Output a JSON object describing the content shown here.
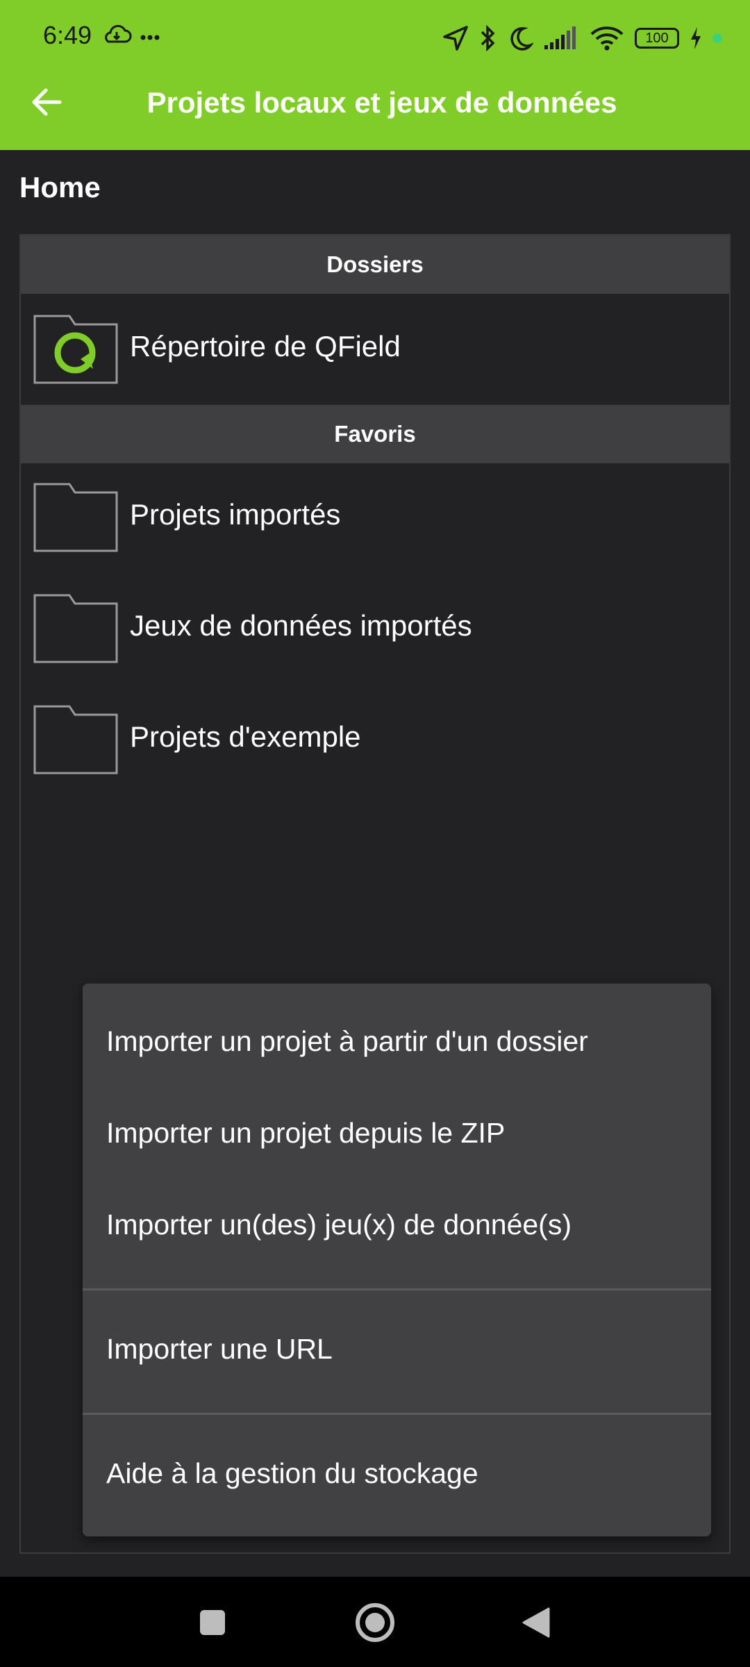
{
  "status_bar": {
    "time": "6:49",
    "battery": "100",
    "icons": [
      "cloud-download-icon",
      "more-dots-icon",
      "location-icon",
      "bluetooth-icon",
      "moon-icon",
      "signal-icon",
      "wifi-icon",
      "battery-icon",
      "charging-icon"
    ]
  },
  "appbar": {
    "title": "Projets locaux et jeux de données",
    "back_icon": "arrow-left-icon"
  },
  "breadcrumb": "Home",
  "sections": {
    "folders_header": "Dossiers",
    "favorites_header": "Favoris"
  },
  "folders": [
    {
      "label": "Répertoire de QField",
      "icon": "qfield-folder-icon"
    }
  ],
  "favorites": [
    {
      "label": "Projets importés",
      "icon": "folder-icon"
    },
    {
      "label": "Jeux de données importés",
      "icon": "folder-icon"
    },
    {
      "label": "Projets d'exemple",
      "icon": "folder-icon"
    }
  ],
  "menu": {
    "items": [
      "Importer un projet à partir d'un dossier",
      "Importer un projet depuis le ZIP",
      "Importer un(des) jeu(x) de donnée(s)",
      "Importer une URL",
      "Aide à la gestion du stockage"
    ]
  },
  "colors": {
    "accent": "#80cc28",
    "background": "#222224",
    "section_header": "#3f3f41",
    "menu_bg": "#414143"
  },
  "navbar": {
    "icons": [
      "recents-square-icon",
      "home-circle-icon",
      "back-triangle-icon"
    ]
  }
}
